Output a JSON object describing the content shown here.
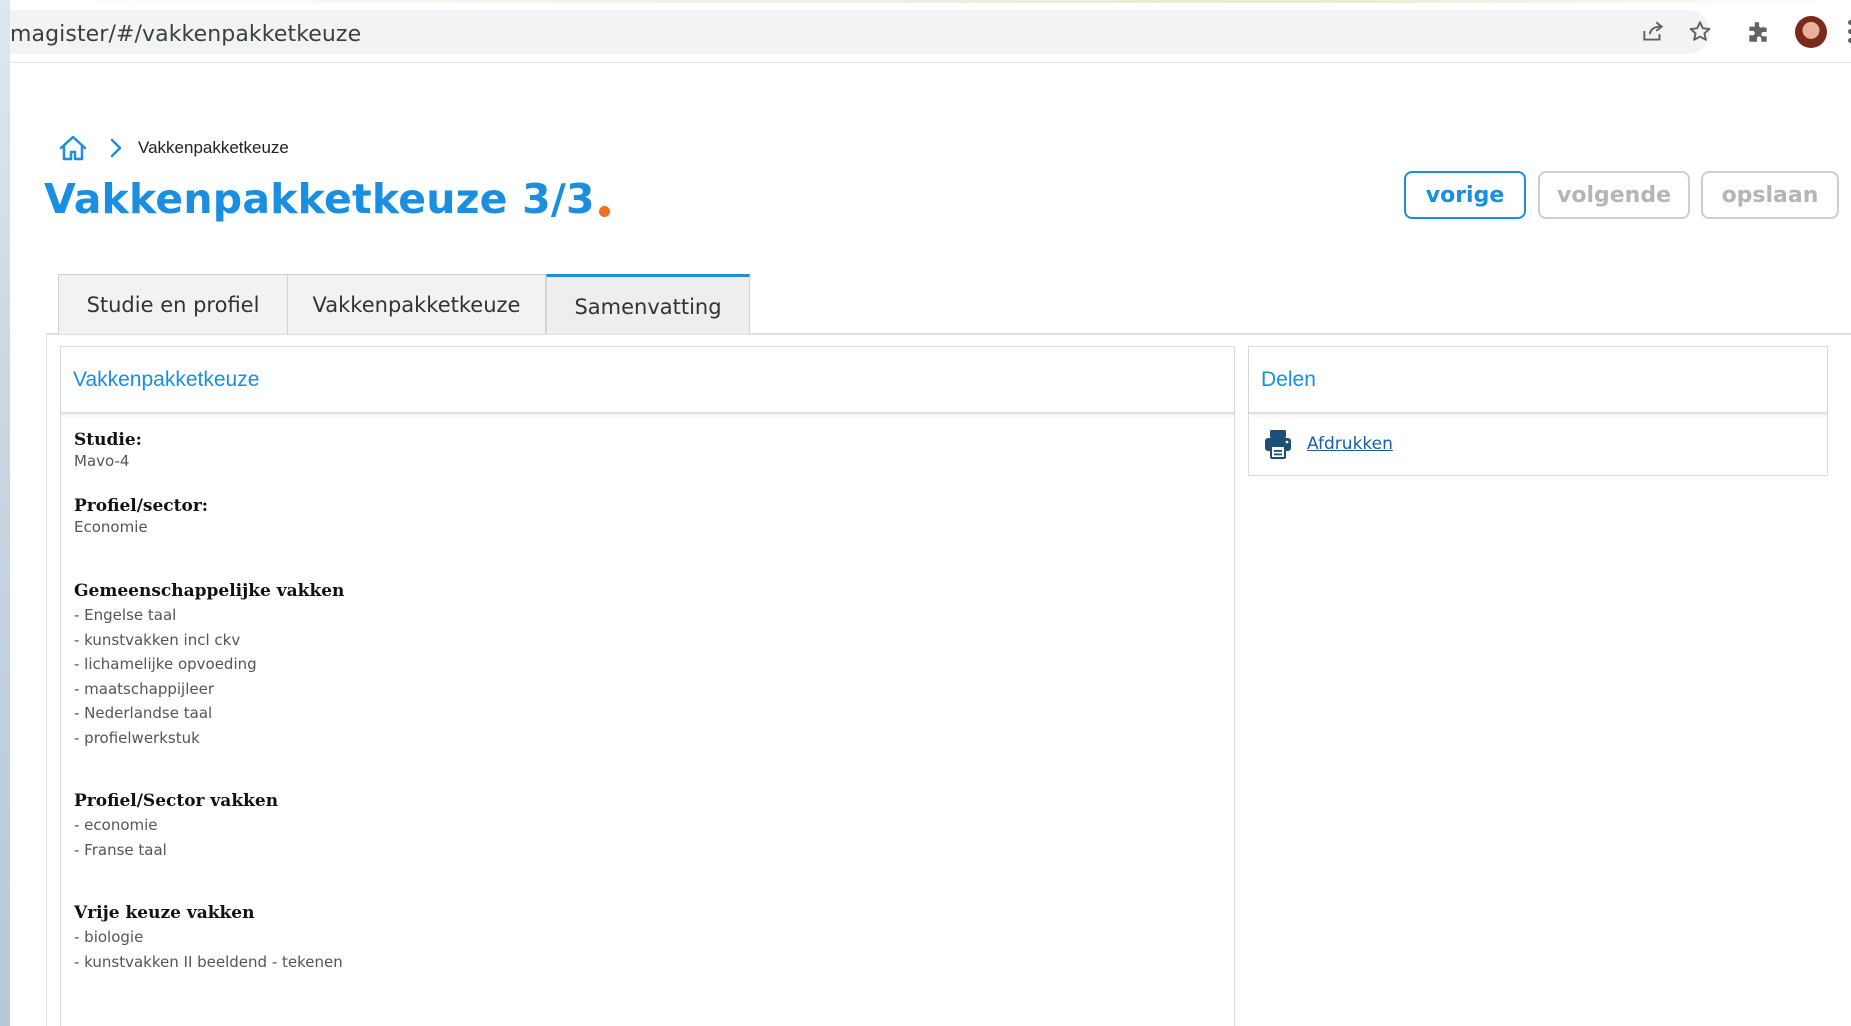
{
  "browser": {
    "url": "magister/#/vakkenpakketkeuze"
  },
  "breadcrumb": {
    "current": "Vakkenpakketkeuze"
  },
  "page": {
    "title": "Vakkenpakketkeuze 3/3"
  },
  "actions": {
    "prev_label": "vorige",
    "next_label": "volgende",
    "save_label": "opslaan"
  },
  "tabs": [
    {
      "label": "Studie en profiel"
    },
    {
      "label": "Vakkenpakketkeuze"
    },
    {
      "label": "Samenvatting",
      "active": true
    }
  ],
  "summary": {
    "heading": "Vakkenpakketkeuze",
    "studie_label": "Studie:",
    "studie_value": "Mavo-4",
    "profiel_label": "Profiel/sector:",
    "profiel_value": "Economie",
    "gemeenschappelijk": {
      "label": "Gemeenschappelijke vakken",
      "items": [
        "- Engelse taal",
        "- kunstvakken incl ckv",
        "- lichamelijke opvoeding",
        "- maatschappijleer",
        "- Nederlandse taal",
        "- profielwerkstuk"
      ]
    },
    "sector": {
      "label": "Profiel/Sector vakken",
      "items": [
        "- economie",
        "- Franse taal"
      ]
    },
    "vrij": {
      "label": "Vrije keuze vakken",
      "items": [
        "- biologie",
        "- kunstvakken II beeldend - tekenen"
      ]
    }
  },
  "share": {
    "heading": "Delen",
    "print_label": "Afdrukken"
  },
  "colors": {
    "accent": "#1a8ee0",
    "title_dot": "#f36f21",
    "link": "#1a5fa8"
  }
}
